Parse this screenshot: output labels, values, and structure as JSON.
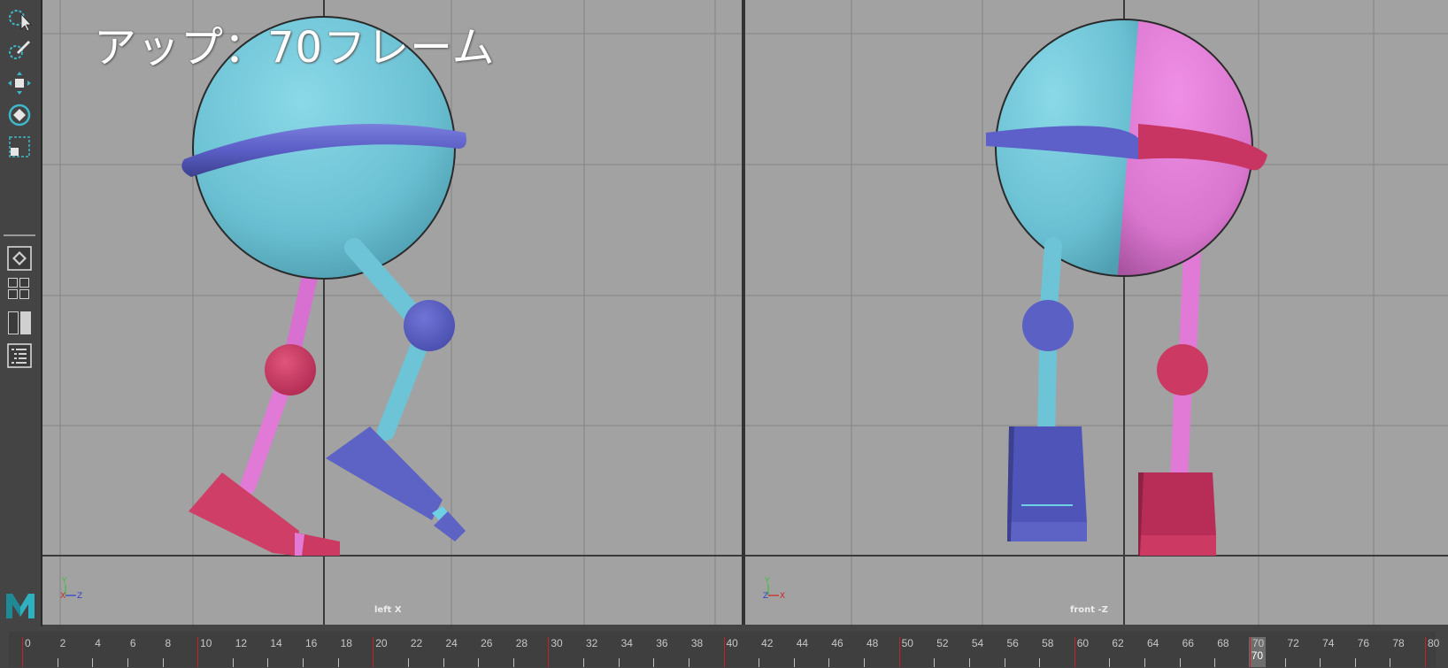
{
  "overlay": {
    "title": "アップ：70フレーム"
  },
  "viewports": {
    "left": {
      "label": "left X",
      "axes": {
        "up": "Y",
        "a": "X",
        "b": "Z"
      }
    },
    "right": {
      "label": "front -Z",
      "axes": {
        "up": "Y",
        "a": "Z",
        "b": "X"
      }
    }
  },
  "toolbox": {
    "tools": [
      "select-tool",
      "lasso-tool",
      "paint-select-tool",
      "move-tool",
      "rotate-tool",
      "scale-tool"
    ],
    "layouts": [
      "single-view-layout",
      "four-view-layout",
      "two-view-layout",
      "outliner-layout"
    ]
  },
  "logo": {
    "letter": "M"
  },
  "timeline": {
    "start": 0,
    "end": 80,
    "step": 2,
    "current_frame": 70,
    "current_label": "70",
    "labels": [
      "0",
      "2",
      "4",
      "6",
      "8",
      "10",
      "12",
      "14",
      "16",
      "18",
      "20",
      "22",
      "24",
      "26",
      "28",
      "30",
      "32",
      "34",
      "36",
      "38",
      "40",
      "42",
      "44",
      "46",
      "48",
      "50",
      "52",
      "54",
      "56",
      "58",
      "60",
      "62",
      "64",
      "66",
      "68",
      "70",
      "72",
      "74",
      "76",
      "78",
      "80"
    ]
  },
  "colors": {
    "body_cyan": "#72c5d6",
    "band_blue": "#5b5fc9",
    "joint_red": "#cf3a64",
    "leg_pink": "#e07ad6",
    "foot_blue": "#5c63c4",
    "foot_red": "#cc3a64",
    "grid": "#808080",
    "viewport_bg": "#a2a2a2",
    "major_tick": "#c8202b"
  }
}
